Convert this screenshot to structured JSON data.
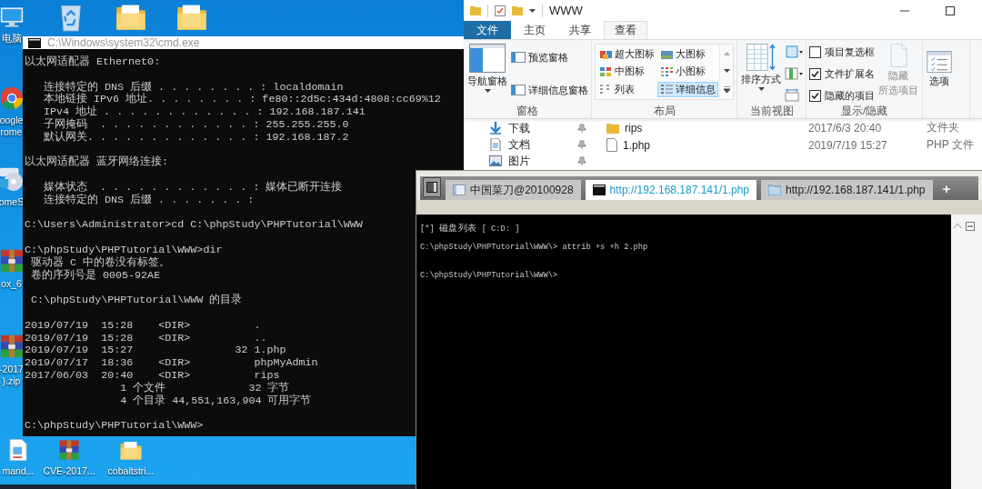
{
  "desktop_icons": [
    {
      "kind": "computer",
      "lines": [
        "电脑"
      ]
    },
    {
      "kind": "recycle-bin"
    },
    {
      "kind": "folder"
    },
    {
      "kind": "folder"
    },
    {
      "kind": "chrome",
      "lines": [
        "oogle",
        "rome"
      ]
    },
    {
      "kind": "disc",
      "lines": [
        "omeS"
      ]
    },
    {
      "kind": "archive",
      "lines": [
        "ox_6"
      ]
    },
    {
      "kind": "archive",
      "lines": [
        "-2017",
        ").zip"
      ]
    },
    {
      "kind": "document",
      "lines": [
        "mand..."
      ]
    },
    {
      "kind": "archive",
      "lines": [
        "CVE-2017..."
      ]
    },
    {
      "kind": "folder",
      "lines": [
        "cobaltstri..."
      ]
    }
  ],
  "cmd": {
    "title": "C:\\Windows\\system32\\cmd.exe",
    "blocks": [
      [
        "以太网适配器 Ethernet0:"
      ],
      [
        "   连接特定的 DNS 后缀 . . . . . . . . : localdomain",
        "   本地链接 IPv6 地址. . . . . . . . : fe80::2d5c:434d:4808:cc69%12",
        "   IPv4 地址 . . . . . . . . . . . . : 192.168.187.141",
        "   子网掩码  . . . . . . . . . . . . : 255.255.255.0",
        "   默认网关. . . . . . . . . . . . . : 192.168.187.2"
      ],
      [
        "以太网适配器 蓝牙网络连接:"
      ],
      [
        "   媒体状态  . . . . . . . . . . . . : 媒体已断开连接",
        "   连接特定的 DNS 后缀 . . . . . . . :"
      ],
      [
        "C:\\Users\\Administrator>cd C:\\phpStudy\\PHPTutorial\\WWW"
      ],
      [
        "C:\\phpStudy\\PHPTutorial\\WWW>dir",
        " 驱动器 C 中的卷没有标签。",
        " 卷的序列号是 0005-92AE"
      ],
      [
        " C:\\phpStudy\\PHPTutorial\\WWW 的目录"
      ],
      [
        "2019/07/19  15:28    <DIR>          .",
        "2019/07/19  15:28    <DIR>          ..",
        "2019/07/19  15:27                32 1.php",
        "2019/07/17  18:36    <DIR>          phpMyAdmin",
        "2017/06/03  20:40    <DIR>          rips",
        "               1 个文件             32 字节",
        "               4 个目录 44,551,163,904 可用字节"
      ],
      [
        "C:\\phpStudy\\PHPTutorial\\WWW>"
      ]
    ]
  },
  "explorer": {
    "title": "WWW",
    "ribbon_tabs": [
      {
        "label": "文件",
        "kind": "menu",
        "selected": false
      },
      {
        "label": "主页",
        "kind": "tab",
        "selected": false
      },
      {
        "label": "共享",
        "kind": "tab",
        "selected": false
      },
      {
        "label": "查看",
        "kind": "tab",
        "selected": true
      }
    ],
    "ribbon_groups": [
      {
        "kind": "panes",
        "label": "窗格",
        "large": {
          "label": "导航窗格"
        },
        "small": [
          {
            "label": "预览窗格"
          },
          {
            "label": "详细信息窗格"
          }
        ]
      },
      {
        "kind": "layout",
        "label": "布局",
        "options": [
          {
            "label": "超大图标",
            "selected": false
          },
          {
            "label": "大图标",
            "selected": false
          },
          {
            "label": "中图标",
            "selected": false
          },
          {
            "label": "小图标",
            "selected": false
          },
          {
            "label": "列表",
            "selected": false
          },
          {
            "label": "详细信息",
            "selected": true
          }
        ]
      },
      {
        "kind": "view",
        "label": "当前视图",
        "large": {
          "label": "排序方式"
        }
      },
      {
        "kind": "show-hide",
        "label": "显示/隐藏",
        "checkboxes": [
          {
            "label": "项目复选框",
            "checked": false
          },
          {
            "label": "文件扩展名",
            "checked": true
          },
          {
            "label": "隐藏的项目",
            "checked": true
          }
        ],
        "large": {
          "lines": [
            "隐藏",
            "所选项目"
          ],
          "disabled": true
        }
      },
      {
        "kind": "options",
        "large": {
          "label": "选项"
        }
      }
    ],
    "nav_items": [
      {
        "label": "下载",
        "kind": "download"
      },
      {
        "label": "文档",
        "kind": "document"
      },
      {
        "label": "图片",
        "kind": "picture"
      }
    ],
    "files": [
      {
        "name": "rips",
        "kind": "folder",
        "modified": "2017/6/3 20:40",
        "type": "文件夹"
      },
      {
        "name": "1.php",
        "kind": "file",
        "modified": "2019/7/19 15:27",
        "type": "PHP 文件"
      }
    ]
  },
  "caidao": {
    "tabs": [
      {
        "label": "中国菜刀@20100928",
        "kind": "home",
        "selected": false
      },
      {
        "label": "http://192.168.187.141/1.php",
        "kind": "shell",
        "selected": true
      },
      {
        "label": "http://192.168.187.141/1.php",
        "kind": "files",
        "selected": false
      }
    ],
    "new_tab": "+",
    "console": [
      [
        "[*] 磁盘列表 [ C:D: ]",
        "C:\\phpStudy\\PHPTutorial\\WWW\\> attrib +s +h 2.php"
      ],
      [
        "C:\\phpStudy\\PHPTutorial\\WWW\\>"
      ]
    ]
  }
}
